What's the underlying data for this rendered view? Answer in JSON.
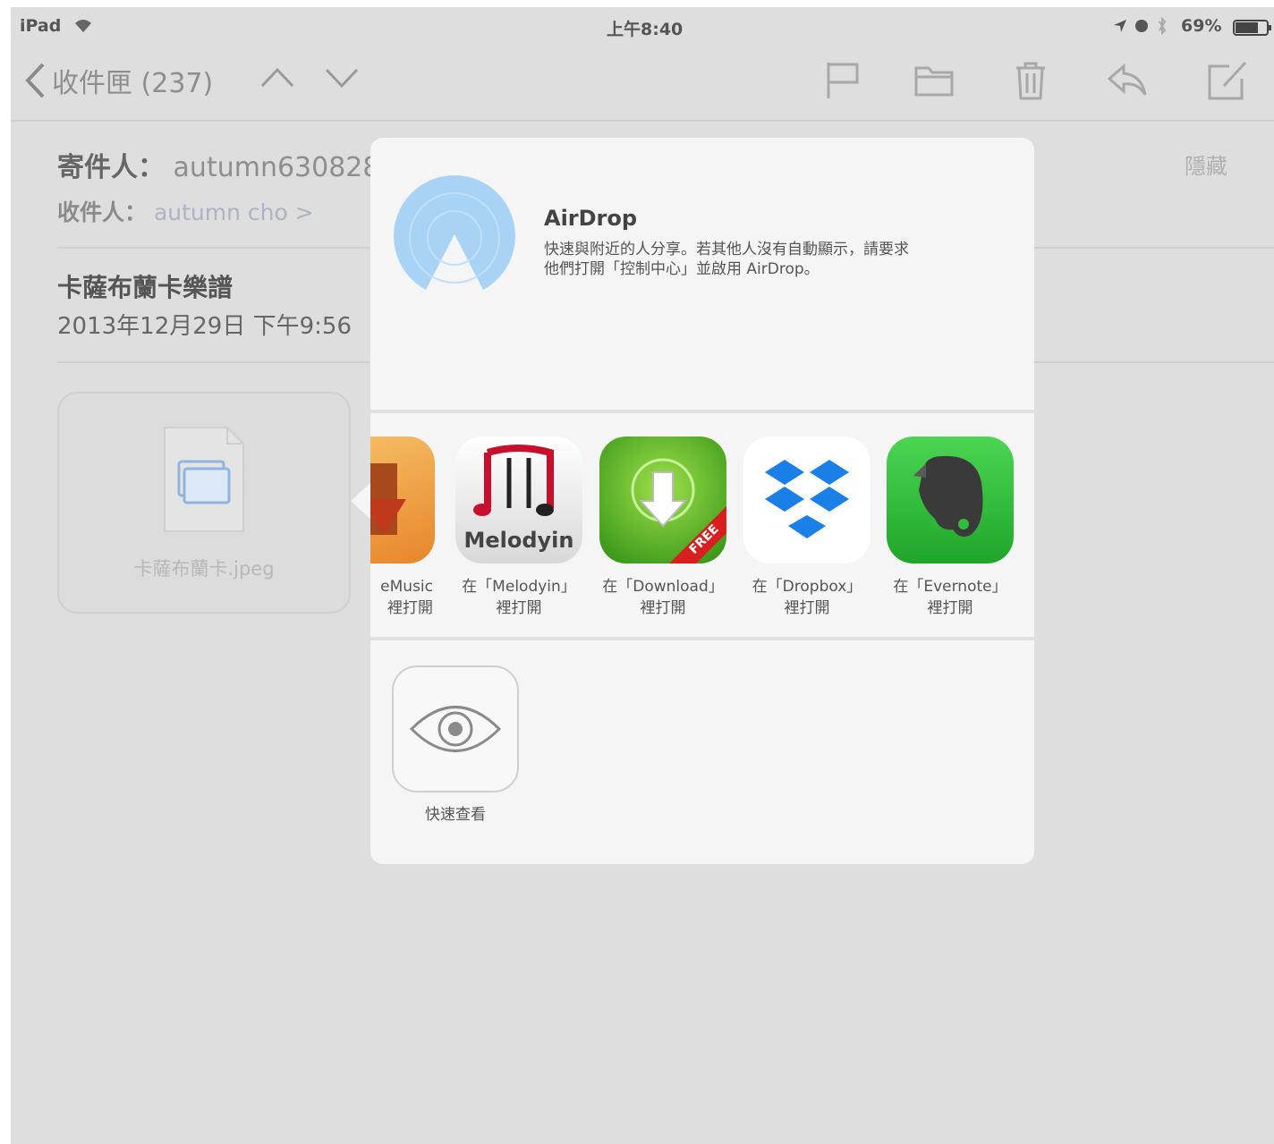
{
  "status_bar": {
    "device": "iPad",
    "time": "上午8:40",
    "battery": "69%"
  },
  "navbar": {
    "back_label": "收件匣 (237)"
  },
  "mail": {
    "from_label": "寄件人：",
    "from_value": "autumn630828",
    "hide_label": "隱藏",
    "to_label": "收件人：",
    "to_value": "autumn cho >",
    "subject": "卡薩布蘭卡樂譜",
    "date": "2013年12月29日 下午9:56",
    "attachment_name": "卡薩布蘭卡.jpeg"
  },
  "share_sheet": {
    "airdrop_title": "AirDrop",
    "airdrop_desc_line1": "快速與附近的人分享。若其他人沒有自動顯示，請要求",
    "airdrop_desc_line2": "他們打開「控制中心」並啟用 AirDrop。",
    "apps": [
      {
        "line1": "eMusic",
        "line2": "裡打開",
        "icon": "emusic-icon"
      },
      {
        "line1": "在「Melodyin」",
        "line2": "裡打開",
        "icon": "melodyin-icon",
        "icon_text": "Melodyin"
      },
      {
        "line1": "在「Download」",
        "line2": "裡打開",
        "icon": "download-icon",
        "badge": "FREE"
      },
      {
        "line1": "在「Dropbox」",
        "line2": "裡打開",
        "icon": "dropbox-icon"
      },
      {
        "line1": "在「Evernote」",
        "line2": "裡打開",
        "icon": "evernote-icon"
      }
    ],
    "quick_look_label": "快速查看"
  },
  "colors": {
    "screen_bg": "#dedede",
    "sheet_bg": "#f5f5f5",
    "airdrop_blue": "#a9d3f5",
    "evernote_green": "#2fbf3a",
    "dropbox_blue": "#1a7fe6"
  }
}
